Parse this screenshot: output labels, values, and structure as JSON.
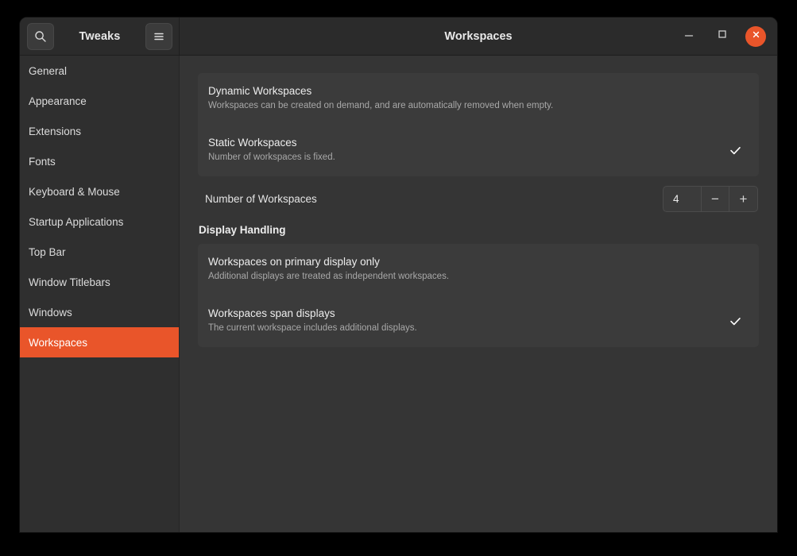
{
  "window": {
    "app_title": "Tweaks",
    "title": "Workspaces",
    "search_icon": "search-icon",
    "menu_icon": "hamburger-menu-icon",
    "minimize_icon": "minimize-icon",
    "maximize_icon": "maximize-icon",
    "close_icon": "close-icon",
    "accent_color": "#e9552a",
    "background_color": "#353535",
    "headerbar_color": "#2b2b2b"
  },
  "sidebar": {
    "items": [
      {
        "label": "General",
        "selected": false
      },
      {
        "label": "Appearance",
        "selected": false
      },
      {
        "label": "Extensions",
        "selected": false
      },
      {
        "label": "Fonts",
        "selected": false
      },
      {
        "label": "Keyboard & Mouse",
        "selected": false
      },
      {
        "label": "Startup Applications",
        "selected": false
      },
      {
        "label": "Top Bar",
        "selected": false
      },
      {
        "label": "Window Titlebars",
        "selected": false
      },
      {
        "label": "Windows",
        "selected": false
      },
      {
        "label": "Workspaces",
        "selected": true
      }
    ]
  },
  "main": {
    "workspace_mode": {
      "options": [
        {
          "title": "Dynamic Workspaces",
          "subtitle": "Workspaces can be created on demand, and are automatically removed when empty.",
          "checked": false
        },
        {
          "title": "Static Workspaces",
          "subtitle": "Number of workspaces is fixed.",
          "checked": true
        }
      ]
    },
    "workspace_count": {
      "label": "Number of Workspaces",
      "value": "4",
      "decrement_label": "−",
      "increment_label": "+"
    },
    "display_handling": {
      "heading": "Display Handling",
      "options": [
        {
          "title": "Workspaces on primary display only",
          "subtitle": "Additional displays are treated as independent workspaces.",
          "checked": false
        },
        {
          "title": "Workspaces span displays",
          "subtitle": "The current workspace includes additional displays.",
          "checked": true
        }
      ]
    }
  }
}
